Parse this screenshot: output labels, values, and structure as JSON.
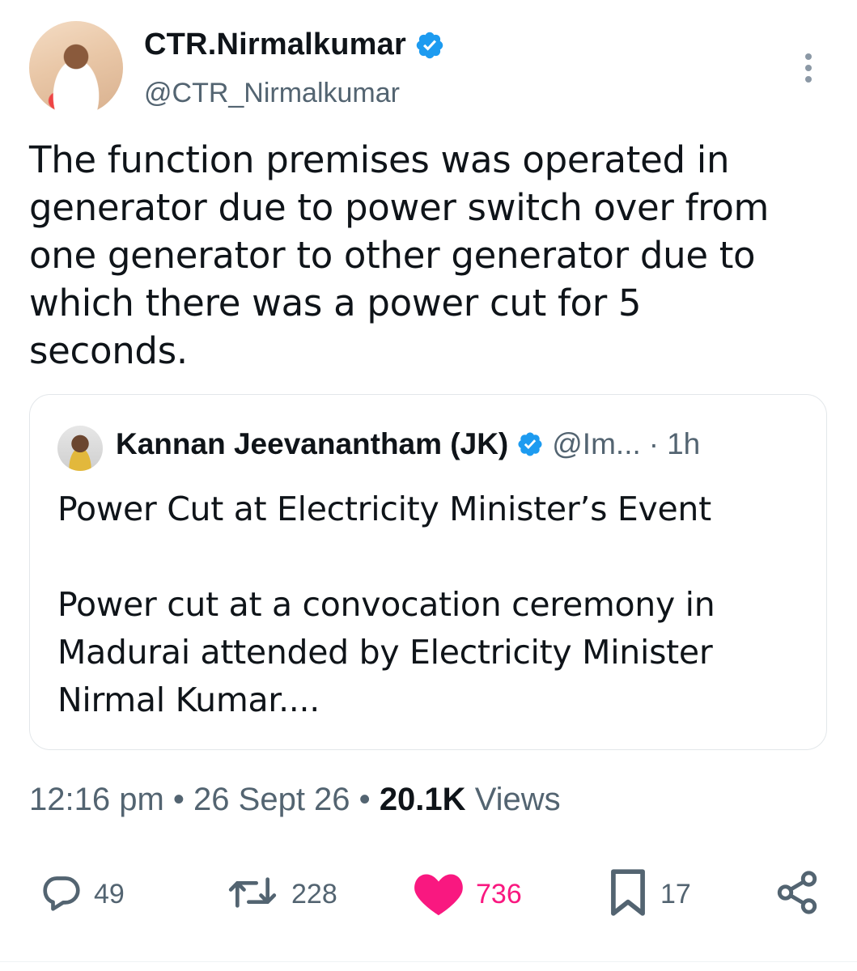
{
  "author": {
    "display_name": "CTR.Nirmalkumar",
    "handle": "@CTR_Nirmalkumar",
    "verified": true
  },
  "tweet_text": "The function premises was operated in\ngenerator due to power switch over from\none generator to other generator due to\nwhich there was a power cut for 5\nseconds.",
  "quoted_tweet": {
    "display_name": "Kannan Jeevanantham (JK)",
    "handle": "@Im...",
    "separator": "·",
    "time": "1h",
    "text": "Power Cut at Electricity Minister’s Event\n\nPower cut at a convocation ceremony in\nMadurai attended by Electricity Minister\nNirmal Kumar...."
  },
  "meta": {
    "time": "12:16 pm",
    "date": "26 Sept 26",
    "views_count": "20.1K",
    "views_label": "Views",
    "separator": "•"
  },
  "actions": {
    "replies": "49",
    "reposts": "228",
    "likes": "736",
    "bookmarks": "17"
  },
  "colors": {
    "verified_blue": "#1d9bf0",
    "like_pink": "#f91880",
    "secondary_text": "#536471",
    "primary_text": "#0f1419"
  },
  "icons": [
    "verified-badge-icon",
    "more-icon",
    "reply-icon",
    "repost-icon",
    "like-icon",
    "bookmark-icon",
    "share-icon"
  ]
}
